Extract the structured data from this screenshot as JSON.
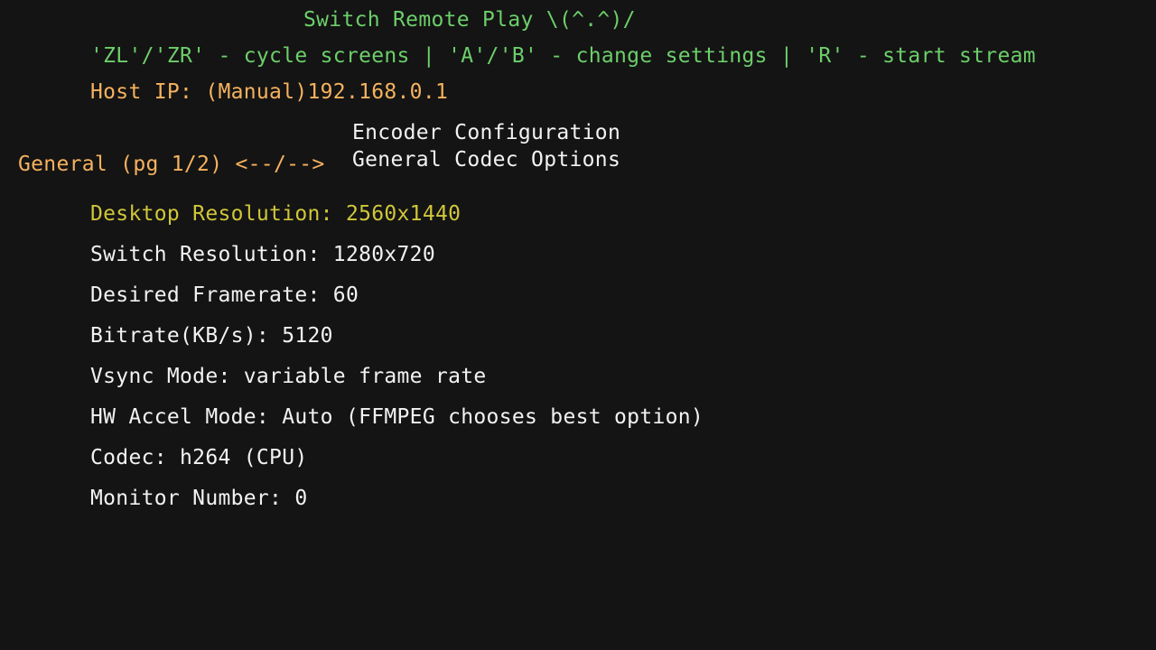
{
  "header": {
    "title": "Switch Remote Play \\(^.^)/",
    "controls_hint": "'ZL'/'ZR' - cycle screens | 'A'/'B' - change settings | 'R' - start stream",
    "host_ip": "Host IP: (Manual)192.168.0.1"
  },
  "screen": {
    "title": "Encoder Configuration",
    "subtitle": "General Codec Options",
    "page_indicator": "General (pg 1/2) <--/-->"
  },
  "settings": [
    {
      "label": "Desktop Resolution: 2560x1440",
      "selected": true
    },
    {
      "label": "Switch Resolution: 1280x720",
      "selected": false
    },
    {
      "label": "Desired Framerate: 60",
      "selected": false
    },
    {
      "label": "Bitrate(KB/s): 5120",
      "selected": false
    },
    {
      "label": "Vsync Mode: variable frame rate",
      "selected": false
    },
    {
      "label": "HW Accel Mode: Auto (FFMPEG chooses best option)",
      "selected": false
    },
    {
      "label": "Codec: h264 (CPU)",
      "selected": false
    },
    {
      "label": "Monitor Number: 0",
      "selected": false
    }
  ],
  "colors": {
    "background": "#141414",
    "title_green": "#6ccf6a",
    "info_orange": "#f6b25e",
    "selected_yellow": "#cfc63a",
    "text_white": "#f2f2f2"
  }
}
